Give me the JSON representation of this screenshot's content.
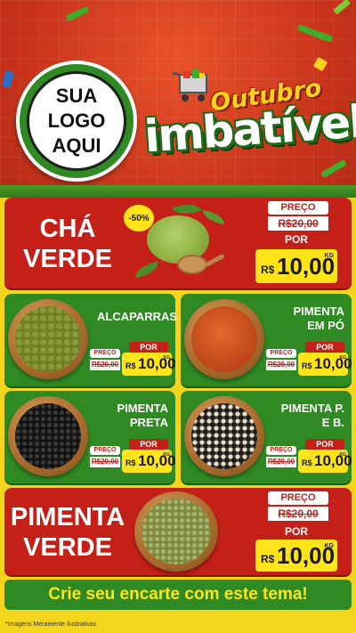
{
  "header": {
    "logo_line1": "SUA",
    "logo_line2": "LOGO",
    "logo_line3": "AQUI",
    "brand_small": "Outubro",
    "brand_big": "imbatível"
  },
  "featured_top": {
    "name_line1": "CHÁ",
    "name_line2": "VERDE",
    "discount": "-50%",
    "preco_label": "PREÇO",
    "old_price": "R$20,00",
    "por_label": "POR",
    "currency": "R$",
    "price": "10,00",
    "unit": "KG"
  },
  "products": [
    {
      "name": "ALCAPARRAS",
      "preco_label": "PREÇO",
      "old_price": "R$20,00",
      "por_label": "POR",
      "currency": "R$",
      "price": "10,00",
      "unit": "KG"
    },
    {
      "name": "PIMENTA EM PÓ",
      "preco_label": "PREÇO",
      "old_price": "R$20,00",
      "por_label": "POR",
      "currency": "R$",
      "price": "10,00",
      "unit": "KG"
    },
    {
      "name": "PIMENTA PRETA",
      "preco_label": "PREÇO",
      "old_price": "R$20,00",
      "por_label": "POR",
      "currency": "R$",
      "price": "10,00",
      "unit": "KG"
    },
    {
      "name": "PIMENTA P. E B.",
      "preco_label": "PREÇO",
      "old_price": "R$20,00",
      "por_label": "POR",
      "currency": "R$",
      "price": "10,00",
      "unit": "KG"
    }
  ],
  "featured_bottom": {
    "name_line1": "PIMENTA",
    "name_line2": "VERDE",
    "preco_label": "PREÇO",
    "old_price": "R$20,00",
    "por_label": "POR",
    "currency": "R$",
    "price": "10,00",
    "unit": "KG"
  },
  "banner_text": "Crie seu encarte com este tema!",
  "footnote": "*Imagens Meramente Ilustrativas",
  "colors": {
    "red": "#c52018",
    "green": "#2f8a24",
    "yellow": "#ffe419",
    "background_yellow": "#f4d51c"
  }
}
